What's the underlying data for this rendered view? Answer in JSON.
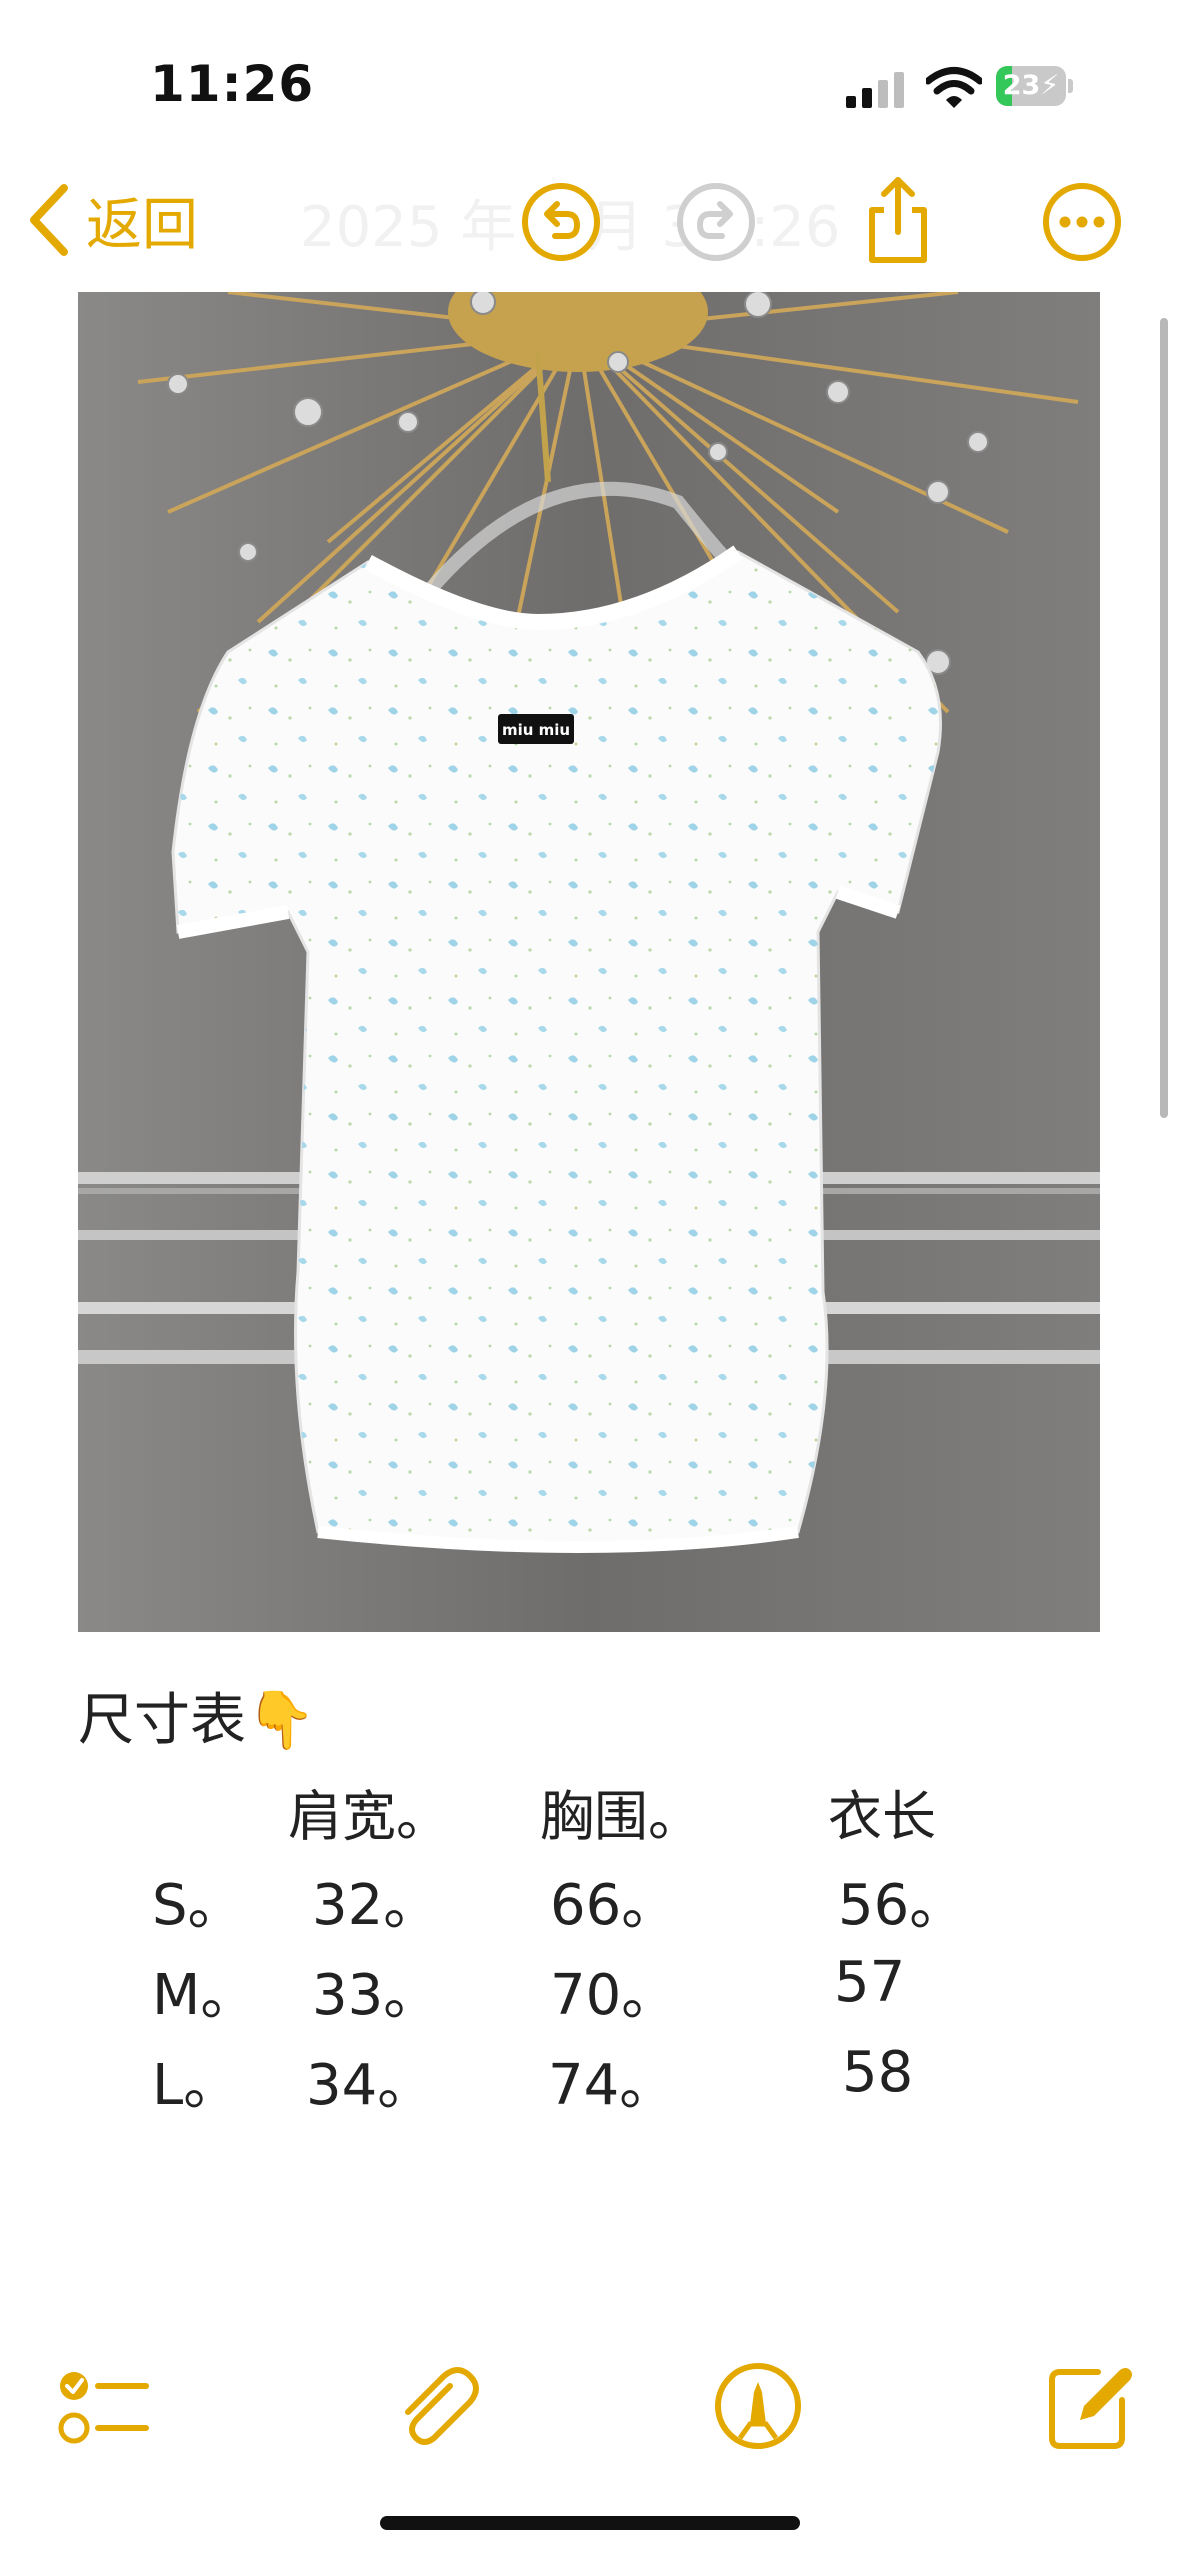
{
  "status_bar": {
    "time": "11:26",
    "battery_percent": "23",
    "battery_level": 0.23,
    "signal_bars_active": 2,
    "icons": [
      "cellular-signal-icon",
      "wifi-icon",
      "battery-charging-icon"
    ]
  },
  "nav": {
    "back_label": "返回",
    "faded_title": "2025 年 3 月 3  1:26",
    "icons": [
      "chevron-left-icon",
      "undo-icon",
      "redo-icon",
      "share-icon",
      "more-icon"
    ]
  },
  "note": {
    "title": "尺寸表👇",
    "headers": [
      "肩宽。",
      "胸围。",
      "衣长"
    ],
    "rows": [
      {
        "size": "S。",
        "shoulder": "32。",
        "chest": "66。",
        "length": "56。"
      },
      {
        "size": "M。",
        "shoulder": "33。",
        "chest": "70。",
        "length": "57"
      },
      {
        "size": "L。",
        "shoulder": "34。",
        "chest": "74。",
        "length": "58"
      }
    ]
  },
  "photo": {
    "label": "miu miu"
  },
  "toolbar": {
    "icons": [
      "checklist-icon",
      "paperclip-icon",
      "markup-pen-icon",
      "compose-icon"
    ]
  },
  "colors": {
    "accent": "#e3a900",
    "battery_green": "#34c759"
  }
}
